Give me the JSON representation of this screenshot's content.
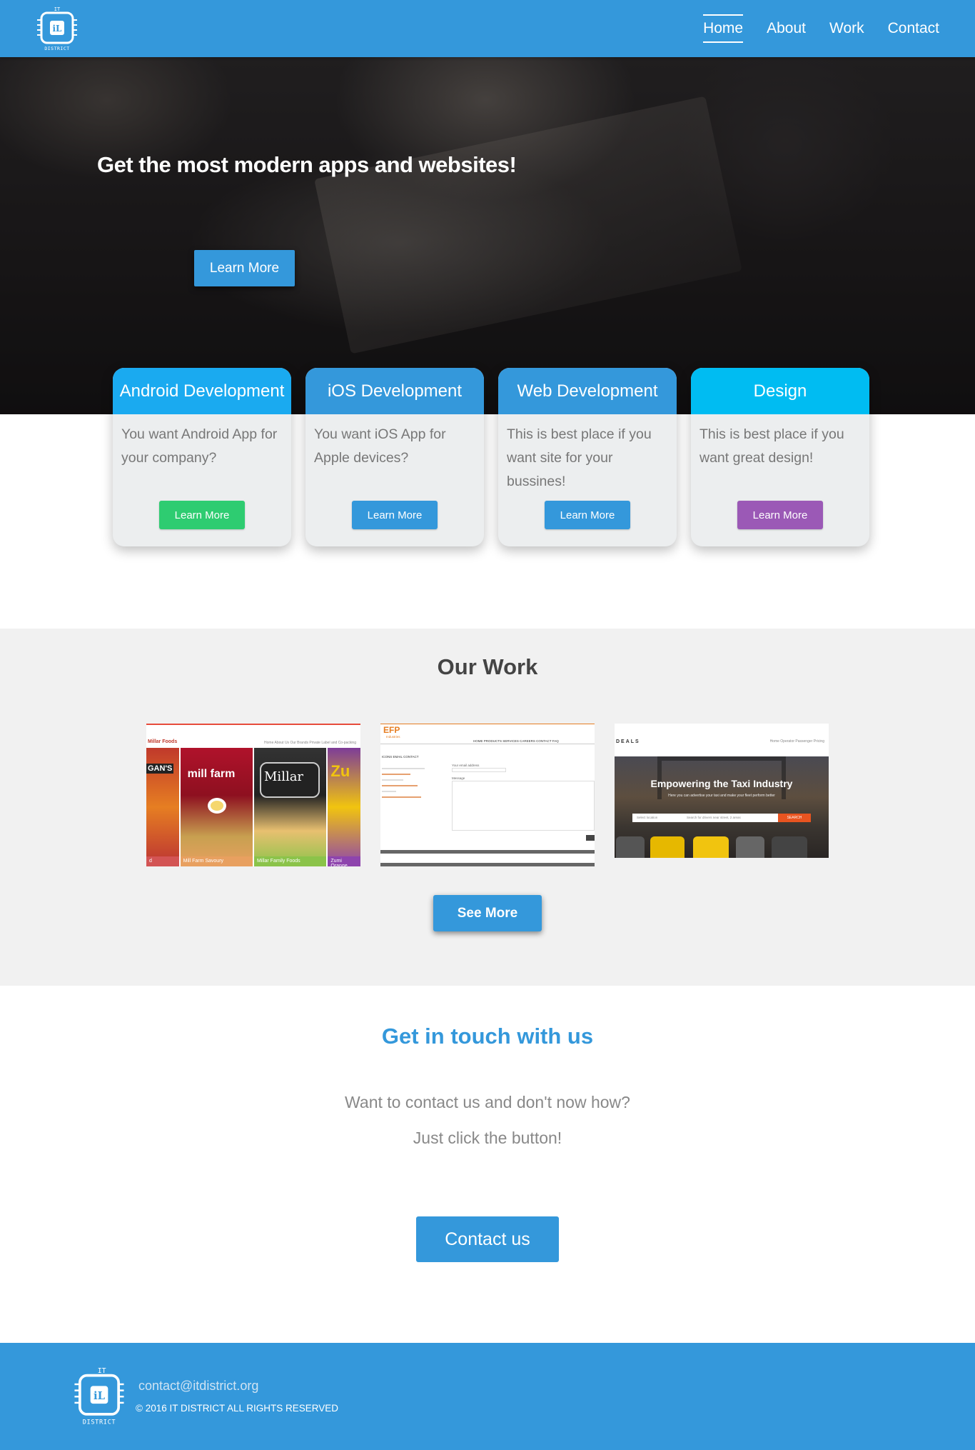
{
  "nav": {
    "logo_top": "IT",
    "logo_bottom": "DISTRICT",
    "links": [
      {
        "label": "Home",
        "active": true
      },
      {
        "label": "About",
        "active": false
      },
      {
        "label": "Work",
        "active": false
      },
      {
        "label": "Contact",
        "active": false
      }
    ]
  },
  "hero": {
    "title": "Get the most modern apps and websites!",
    "button_label": "Learn More"
  },
  "services": [
    {
      "title": "Android Development",
      "text": "You want Android App for your company?",
      "button_label": "Learn More",
      "button_color": "#2ecc71"
    },
    {
      "title": "iOS Development",
      "text": "You want iOS App for Apple devices?",
      "button_label": "Learn More",
      "button_color": "#3498db"
    },
    {
      "title": "Web Development",
      "text": "This is best place if you want site for your bussines!",
      "button_label": "Learn More",
      "button_color": "#3498db"
    },
    {
      "title": "Design",
      "text": "This is best place if you want great design!",
      "button_label": "Learn More",
      "button_color": "#9b59b6"
    }
  ],
  "work": {
    "title": "Our Work",
    "thumbs": [
      {
        "brand": "Millar Foods",
        "nav": "Home   About Us   Our Brands   Private Label and Co-packing",
        "tiles": [
          "GAN'S",
          "mill farm",
          "Millar",
          "Zu"
        ],
        "captions": [
          "d",
          "Mill Farm Savoury",
          "Millar Family Foods",
          "Zumi Orange"
        ]
      },
      {
        "logo": "EFP",
        "logo_sub": "Industries",
        "menu": "HOME   PRODUCTS   SERVICES   CAREERS   CONTACT   FAQ",
        "heading": "ICONS   EMAIL CONTACT",
        "form_label": "Your email address",
        "message_label": "Message"
      },
      {
        "brand": "DEALS",
        "nav": "Home   Operator   Passenger   Pricing",
        "title": "Empowering the Taxi Industry",
        "subtitle": "Here you can advertise your taxi and make your fleet perform better",
        "search_placeholder": "Search for drivers near street, 2 areas",
        "select_placeholder": "Select location",
        "search_button": "SEARCH"
      }
    ],
    "button_label": "See More"
  },
  "contact": {
    "title": "Get in touch with us",
    "line1": "Want to contact us and don't now how?",
    "line2": "Just click the button!",
    "button_label": "Contact us"
  },
  "footer": {
    "email": "contact@itdistrict.org",
    "copyright": "© 2016 IT DISTRICT ALL RIGHTS RESERVED"
  },
  "colors": {
    "brand_blue": "#3498db",
    "cyan": "#00bcf2",
    "green": "#2ecc71",
    "purple": "#9b59b6"
  }
}
